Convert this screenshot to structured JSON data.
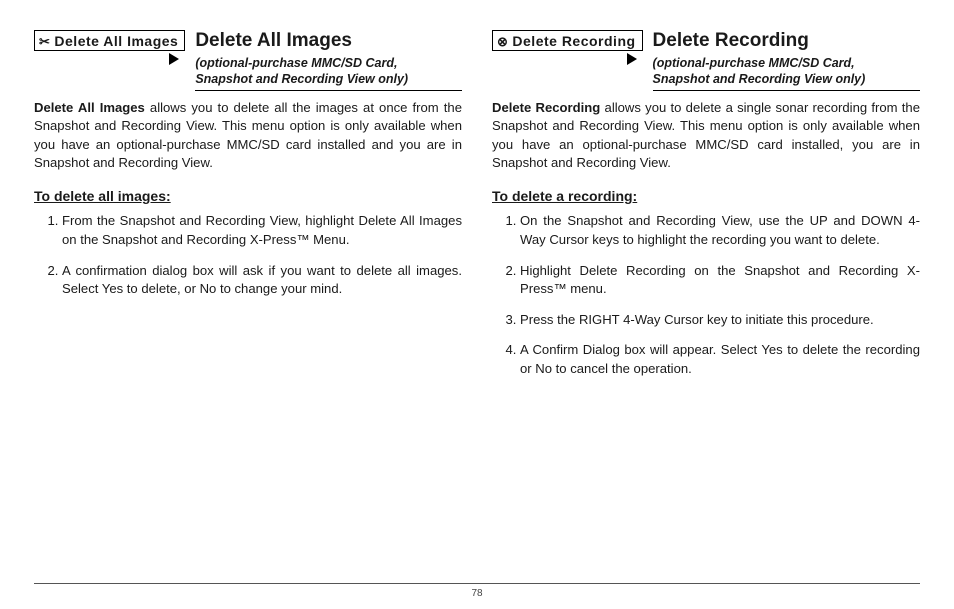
{
  "page_number": "78",
  "left": {
    "menu_label": "Delete All Images",
    "title": "Delete All Images",
    "subtitle_line1": "(optional-purchase MMC/SD Card,",
    "subtitle_line2": "Snapshot and Recording View only)",
    "intro_bold": "Delete All Images",
    "intro_rest": " allows you to delete all the images at once from the Snapshot and Recording View. This menu option is only available when you have an optional-purchase MMC/SD card installed and you are in Snapshot and Recording View.",
    "howto": "To delete all images:",
    "steps": [
      "From the Snapshot and Recording View, highlight Delete All Images on the Snapshot and Recording X-Press™ Menu.",
      "A confirmation dialog box will ask if you want to delete all images. Select Yes to delete, or No to change your mind."
    ]
  },
  "right": {
    "menu_label": "Delete Recording",
    "title": "Delete Recording",
    "subtitle_line1": "(optional-purchase MMC/SD Card,",
    "subtitle_line2": "Snapshot and Recording View only)",
    "intro_bold": "Delete Recording",
    "intro_rest": " allows you to delete a single sonar recording from the Snapshot and Recording View. This menu option is only available when you have an optional-purchase MMC/SD card installed, you are in Snapshot and Recording View.",
    "howto": "To delete a recording:",
    "steps": [
      "On the Snapshot and Recording View, use the UP and DOWN 4-Way Cursor keys to highlight the recording you want to delete.",
      "Highlight Delete Recording on the Snapshot and Recording X-Press™ menu.",
      "Press the RIGHT 4-Way Cursor key to initiate this procedure.",
      "A Confirm Dialog box will appear. Select Yes to delete the recording or No to cancel the operation."
    ]
  }
}
